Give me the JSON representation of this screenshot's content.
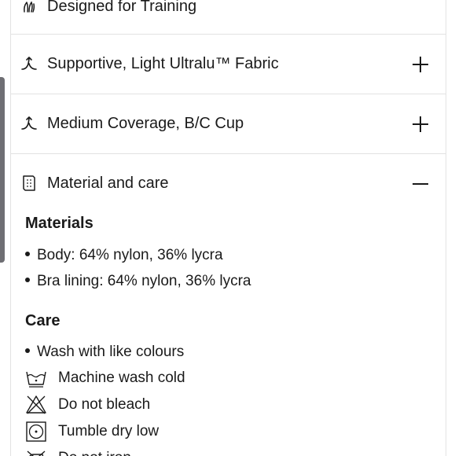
{
  "accordion": {
    "items": [
      {
        "icon": "training-icon",
        "label": "Designed for Training"
      },
      {
        "icon": "stretch-icon",
        "label": "Supportive, Light Ultralu™ Fabric",
        "state": "collapsed"
      },
      {
        "icon": "stretch-icon",
        "label": "Medium Coverage, B/C Cup",
        "state": "collapsed"
      },
      {
        "icon": "fabric-tag-icon",
        "label": "Material and care",
        "state": "expanded"
      }
    ]
  },
  "materials": {
    "heading": "Materials",
    "items": [
      "Body: 64% nylon, 36% lycra",
      "Bra lining: 64% nylon, 36% lycra"
    ]
  },
  "care": {
    "heading": "Care",
    "bullet": "Wash with like colours",
    "instructions": [
      {
        "icon": "machine-wash-cold-icon",
        "label": "Machine wash cold"
      },
      {
        "icon": "do-not-bleach-icon",
        "label": "Do not bleach"
      },
      {
        "icon": "tumble-dry-low-icon",
        "label": "Tumble dry low"
      },
      {
        "icon": "do-not-iron-icon",
        "label": "Do not iron"
      }
    ]
  }
}
